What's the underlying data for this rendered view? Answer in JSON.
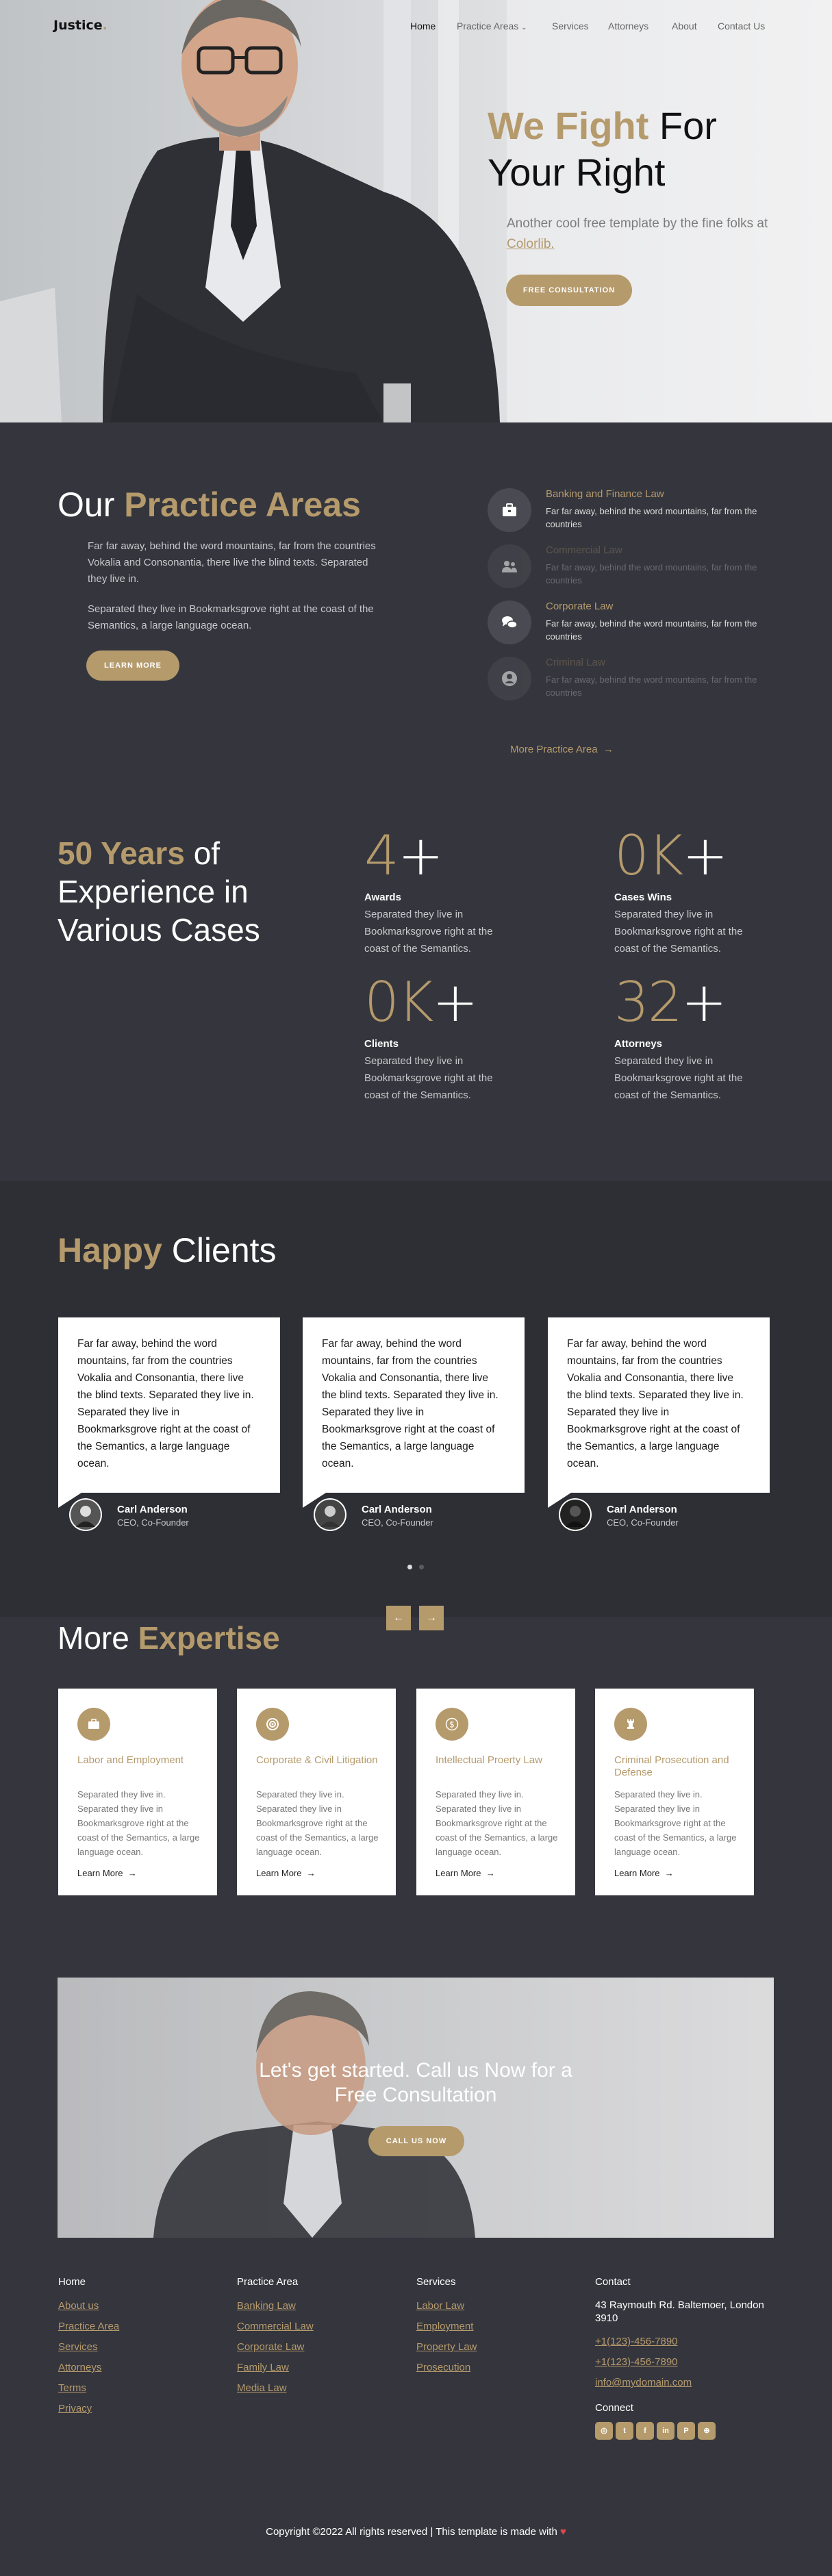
{
  "nav": {
    "logo": "Justice",
    "logo_dot": ".",
    "items": [
      {
        "label": "Home"
      },
      {
        "label": "Practice Areas"
      },
      {
        "label": "Services"
      },
      {
        "label": "Attorneys"
      },
      {
        "label": "About"
      },
      {
        "label": "Contact Us"
      }
    ]
  },
  "hero": {
    "title_accent": "We Fight",
    "title_rest1": " For",
    "title_rest2": "Your Right",
    "subtitle": "Another cool free template by the fine folks at",
    "subtitle_link": "Colorlib.",
    "cta": "Free Consultation"
  },
  "practice": {
    "title_plain": "Our",
    "title_accent": "Practice Areas",
    "para1": "Far far away, behind the word mountains, far from the countries Vokalia and Consonantia, there live the blind texts. Separated they live in.",
    "para2": "Separated they live in Bookmarksgrove right at the coast of the Semantics, a large language ocean.",
    "button": "Learn More",
    "areas": [
      {
        "title": "Banking and Finance Law",
        "desc": "Far far away, behind the word mountains, far from the countries",
        "icon": "briefcase-icon"
      },
      {
        "title": "Commercial Law",
        "desc": "Far far away, behind the word mountains, far from the countries",
        "icon": "users-icon"
      },
      {
        "title": "Corporate Law",
        "desc": "Far far away, behind the word mountains, far from the countries",
        "icon": "chat-icon"
      },
      {
        "title": "Criminal Law",
        "desc": "Far far away, behind the word mountains, far from the countries",
        "icon": "person-icon"
      }
    ],
    "more_link": "More Practice Area"
  },
  "stats": {
    "title_accent": "50 Years",
    "title_rest": "of Experience in Various Cases",
    "items": [
      {
        "number": "4",
        "label": "Awards",
        "desc": "Separated they live in Bookmarksgrove right at the coast of the Semantics."
      },
      {
        "number": "0K",
        "label": "Cases Wins",
        "desc": "Separated they live in Bookmarksgrove right at the coast of the Semantics."
      },
      {
        "number": "0K",
        "label": "Clients",
        "desc": "Separated they live in Bookmarksgrove right at the coast of the Semantics."
      },
      {
        "number": "32",
        "label": "Attorneys",
        "desc": "Separated they live in Bookmarksgrove right at the coast of the Semantics."
      }
    ],
    "plus": "+"
  },
  "clients": {
    "title_accent": "Happy",
    "title_rest": "Clients",
    "testimonials": [
      {
        "text": "Far far away, behind the word mountains, far from the countries Vokalia and Consonantia, there live the blind texts. Separated they live in. Separated they live in Bookmarksgrove right at the coast of the Semantics, a large language ocean.",
        "name": "Carl Anderson",
        "role": "CEO, Co-Founder"
      },
      {
        "text": "Far far away, behind the word mountains, far from the countries Vokalia and Consonantia, there live the blind texts. Separated they live in. Separated they live in Bookmarksgrove right at the coast of the Semantics, a large language ocean.",
        "name": "Carl Anderson",
        "role": "CEO, Co-Founder"
      },
      {
        "text": "Far far away, behind the word mountains, far from the countries Vokalia and Consonantia, there live the blind texts. Separated they live in. Separated they live in Bookmarksgrove right at the coast of the Semantics, a large language ocean.",
        "name": "Carl Anderson",
        "role": "CEO, Co-Founder"
      }
    ]
  },
  "expertise": {
    "title_plain": "More",
    "title_accent": "Expertise",
    "prev": "←",
    "next": "→",
    "cards": [
      {
        "title": "Labor and Employment",
        "desc": "Separated they live in. Separated they live in Bookmarksgrove right at the coast of the Semantics, a large language ocean.",
        "link": "Learn More",
        "icon": "briefcase-icon"
      },
      {
        "title": "Corporate & Civil Litigation",
        "desc": "Separated they live in. Separated they live in Bookmarksgrove right at the coast of the Semantics, a large language ocean.",
        "link": "Learn More",
        "icon": "target-icon"
      },
      {
        "title": "Intellectual Proerty Law",
        "desc": "Separated they live in. Separated they live in Bookmarksgrove right at the coast of the Semantics, a large language ocean.",
        "link": "Learn More",
        "icon": "dollar-icon"
      },
      {
        "title": "Criminal Prosecution and Defense",
        "desc": "Separated they live in. Separated they live in Bookmarksgrove right at the coast of the Semantics, a large language ocean.",
        "link": "Learn More",
        "icon": "chess-rook-icon"
      }
    ]
  },
  "cta": {
    "line1": "Let's get started. Call us Now for a",
    "line2": "Free Consultation",
    "button": "Call Us Now"
  },
  "footer": {
    "col1": {
      "links": [
        "About us",
        "Practice Area",
        "Services",
        "Attorneys",
        "Terms",
        "Privacy"
      ],
      "head": "Home"
    },
    "col2": {
      "head": "Practice Area",
      "links": [
        "Banking Law",
        "Commercial Law",
        "Corporate Law",
        "Family Law",
        "Media Law"
      ]
    },
    "col3": {
      "head": "Services",
      "links": [
        "Labor Law",
        "Employment",
        "Property Law",
        "Prosecution"
      ]
    },
    "contact": {
      "head": "Contact",
      "address": "43 Raymouth Rd. Baltemoer, London 3910",
      "phone1": "+1(123)-456-7890",
      "phone2": "+1(123)-456-7890",
      "email": "info@mydomain.com",
      "connect": "Connect",
      "social": [
        "instagram-icon",
        "twitter-icon",
        "facebook-icon",
        "linkedin-icon",
        "pinterest-icon",
        "dribbble-icon"
      ]
    },
    "copyright": "Copyright ©2022 All rights reserved | This template is made with",
    "heart": "♥"
  },
  "colors": {
    "accent": "#b59a6c",
    "dark_bg": "#35363d",
    "darker_bg": "#2e2f35"
  }
}
